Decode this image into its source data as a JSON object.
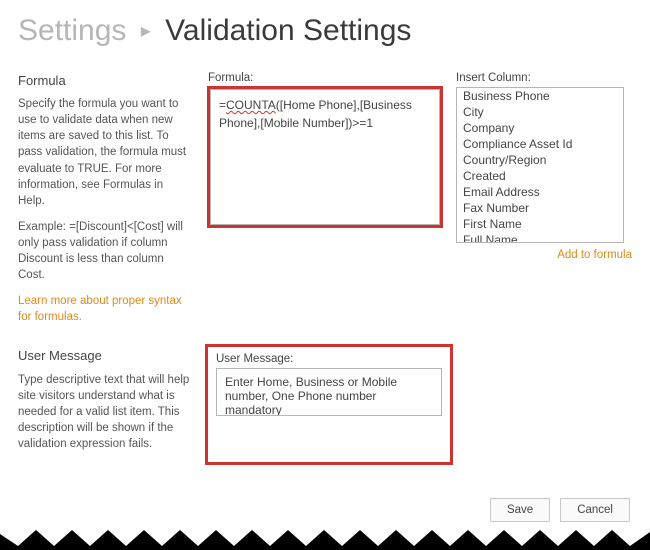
{
  "breadcrumb": {
    "root": "Settings",
    "title": "Validation Settings"
  },
  "formula_section": {
    "heading": "Formula",
    "p1": "Specify the formula you want to use to validate data when new items are saved to this list. To pass validation, the formula must evaluate to TRUE. For more information, see Formulas in Help.",
    "p2": "Example: =[Discount]<[Cost] will only pass validation if column Discount is less than column Cost.",
    "syntax_link": "Learn more about proper syntax for formulas.",
    "formula_label": "Formula:",
    "formula_prefix": "=",
    "formula_func": "COUNTA",
    "formula_tail": "([Home Phone],[Business Phone],[Mobile Number])>=1",
    "insert_label": "Insert Column:",
    "columns": [
      "Business Phone",
      "City",
      "Company",
      "Compliance Asset Id",
      "Country/Region",
      "Created",
      "Email Address",
      "Fax Number",
      "First Name",
      "Full Name"
    ],
    "add_link": "Add to formula"
  },
  "message_section": {
    "heading": "User Message",
    "p1": "Type descriptive text that will help site visitors understand what is needed for a valid list item. This description will be shown if the validation expression fails.",
    "msg_label": "User Message:",
    "msg_value": "Enter Home, Business or Mobile number, One Phone number mandatory"
  },
  "buttons": {
    "save": "Save",
    "cancel": "Cancel"
  }
}
